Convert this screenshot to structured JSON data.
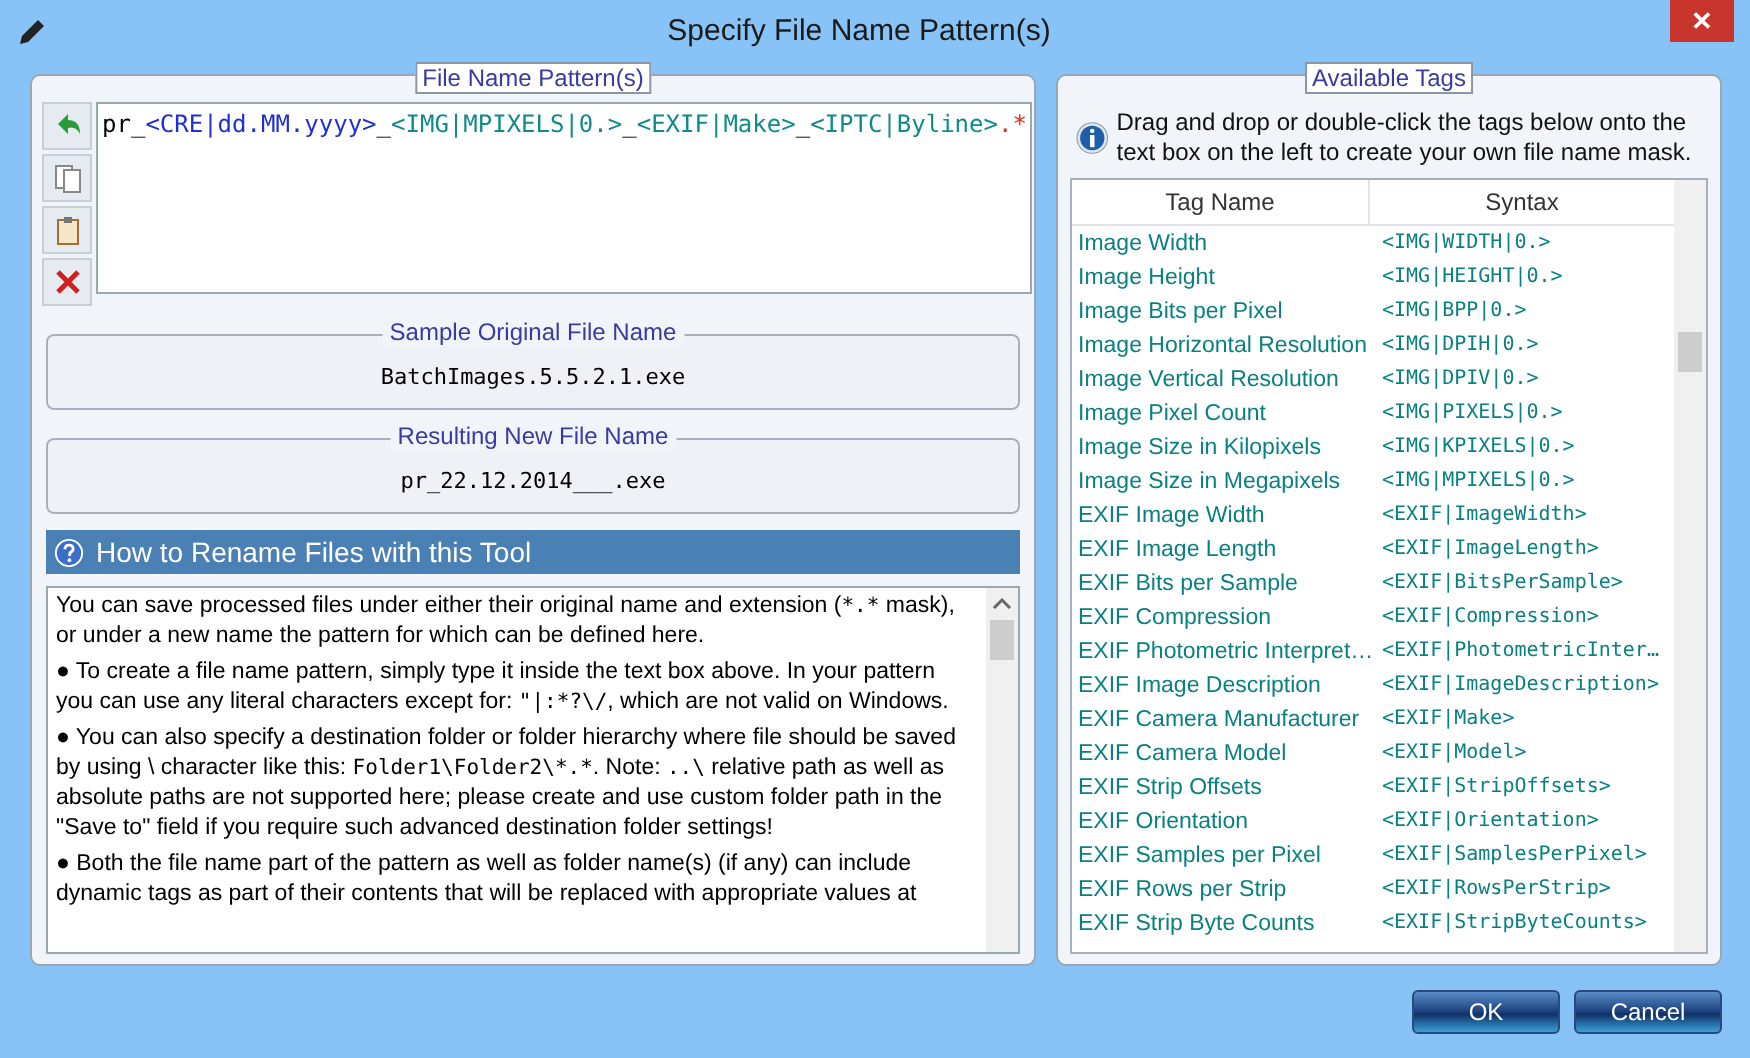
{
  "window": {
    "title": "Specify File Name Pattern(s)",
    "close": "✕"
  },
  "pattern_box": {
    "legend": "File Name Pattern(s)",
    "segments": [
      {
        "text": "pr_",
        "kind": "literal"
      },
      {
        "text": "<CRE|dd.MM.yyyy>",
        "kind": "date"
      },
      {
        "text": "_",
        "kind": "literal"
      },
      {
        "text": "<IMG|MPIXELS|0.>",
        "kind": "tag"
      },
      {
        "text": "_",
        "kind": "literal"
      },
      {
        "text": "<EXIF|Make>",
        "kind": "tag"
      },
      {
        "text": "_",
        "kind": "literal"
      },
      {
        "text": "<IPTC|Byline>",
        "kind": "tag"
      },
      {
        "text": ".*",
        "kind": "extension"
      }
    ]
  },
  "sample": {
    "legend": "Sample Original File Name",
    "value": "BatchImages.5.5.2.1.exe"
  },
  "result": {
    "legend": "Resulting New File Name",
    "value": "pr_22.12.2014___.exe"
  },
  "help": {
    "title": "How to Rename Files with this Tool",
    "paragraphs": [
      [
        {
          "text": "You can save processed files under either their original name and extension (",
          "kind": "text"
        },
        {
          "text": "*.*",
          "kind": "mono"
        },
        {
          "text": " mask), or under a new name the pattern for which can be defined here.",
          "kind": "text"
        }
      ],
      [
        {
          "text": "● To create a file name pattern, simply type it inside the text box above. In your pattern you can use any literal characters except for: ",
          "kind": "text"
        },
        {
          "text": "\"|:*?\\/",
          "kind": "mono"
        },
        {
          "text": ", which are not valid on Windows.",
          "kind": "text"
        }
      ],
      [
        {
          "text": "● You can also specify a destination folder or folder hierarchy where file should be saved by using \\ character like this: ",
          "kind": "text"
        },
        {
          "text": "Folder1\\Folder2\\*.*",
          "kind": "mono"
        },
        {
          "text": ". Note: ",
          "kind": "text"
        },
        {
          "text": "..\\",
          "kind": "mono"
        },
        {
          "text": " relative path as well as absolute paths are not supported here; please create and use custom folder path in the \"Save to\" field if you require such advanced destination folder settings!",
          "kind": "text"
        }
      ],
      [
        {
          "text": "● Both the file name part of the pattern as well as folder name(s) (if any) can include dynamic tags as part of their contents that will be replaced with appropriate values at",
          "kind": "text"
        }
      ]
    ]
  },
  "tags": {
    "legend": "Available Tags",
    "info": "Drag and drop or double-click the tags below onto the text box on the left to create your own file name mask.",
    "columns": [
      "Tag Name",
      "Syntax"
    ],
    "rows": [
      [
        "Image Width",
        "<IMG|WIDTH|0.>"
      ],
      [
        "Image Height",
        "<IMG|HEIGHT|0.>"
      ],
      [
        "Image Bits per Pixel",
        "<IMG|BPP|0.>"
      ],
      [
        "Image Horizontal Resolution",
        "<IMG|DPIH|0.>"
      ],
      [
        "Image Vertical Resolution",
        "<IMG|DPIV|0.>"
      ],
      [
        "Image Pixel Count",
        "<IMG|PIXELS|0.>"
      ],
      [
        "Image Size in Kilopixels",
        "<IMG|KPIXELS|0.>"
      ],
      [
        "Image Size in Megapixels",
        "<IMG|MPIXELS|0.>"
      ],
      [
        "EXIF Image Width",
        "<EXIF|ImageWidth>"
      ],
      [
        "EXIF Image Length",
        "<EXIF|ImageLength>"
      ],
      [
        "EXIF Bits per Sample",
        "<EXIF|BitsPerSample>"
      ],
      [
        "EXIF Compression",
        "<EXIF|Compression>"
      ],
      [
        "EXIF  Photometric  Interpret…",
        "<EXIF|PhotometricInter…"
      ],
      [
        "EXIF Image Description",
        "<EXIF|ImageDescription>"
      ],
      [
        "EXIF Camera Manufacturer",
        "<EXIF|Make>"
      ],
      [
        "EXIF Camera Model",
        "<EXIF|Model>"
      ],
      [
        "EXIF Strip Offsets",
        "<EXIF|StripOffsets>"
      ],
      [
        "EXIF Orientation",
        "<EXIF|Orientation>"
      ],
      [
        "EXIF Samples per Pixel",
        "<EXIF|SamplesPerPixel>"
      ],
      [
        "EXIF Rows per Strip",
        "<EXIF|RowsPerStrip>"
      ],
      [
        "EXIF Strip Byte Counts",
        "<EXIF|StripByteCounts>"
      ]
    ]
  },
  "buttons": [
    "OK",
    "Cancel"
  ]
}
